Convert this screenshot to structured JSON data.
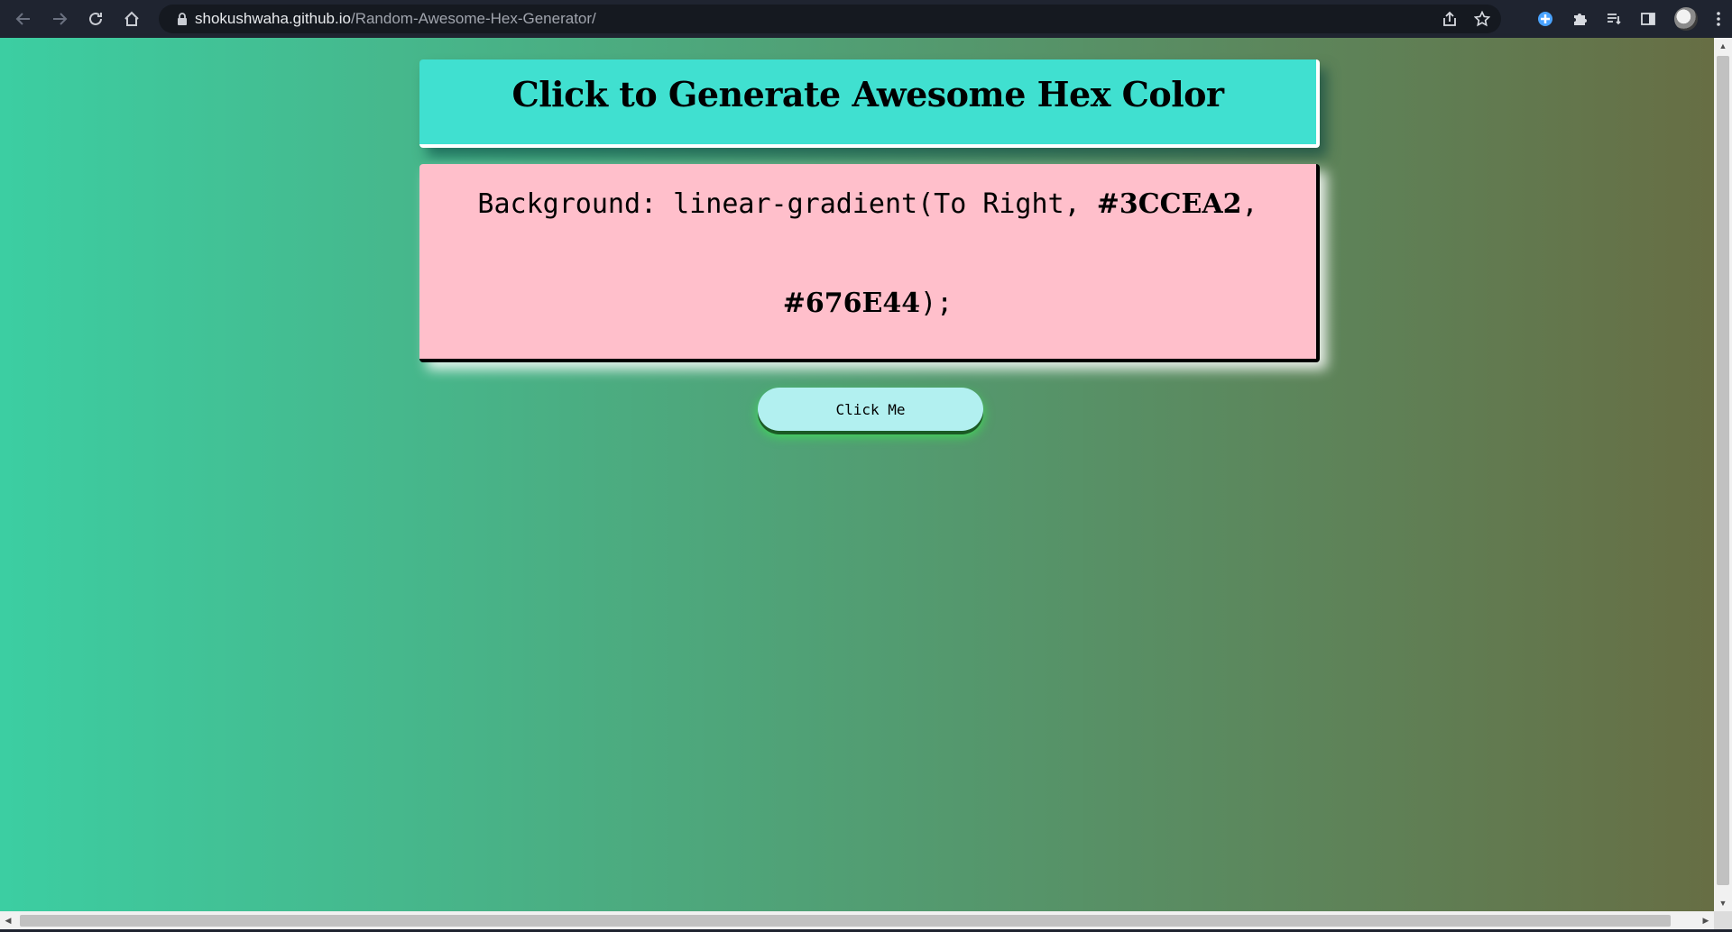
{
  "browser": {
    "url_host": "shokushwaha.github.io",
    "url_path": "/Random-Awesome-Hex-Generator/",
    "icons": {
      "back": "back-arrow-icon",
      "forward": "forward-arrow-icon",
      "reload": "reload-icon",
      "home": "home-icon",
      "lock": "lock-icon",
      "share": "share-icon",
      "bookmark": "star-icon",
      "extension_active": "extension-icon",
      "extensions": "puzzle-icon",
      "reading_list": "reading-list-icon",
      "side_panel": "side-panel-icon",
      "menu": "kebab-menu-icon"
    }
  },
  "page": {
    "heading": "Click to Generate Awesome Hex Color",
    "css_prefix": "Background: linear-gradient(To Right, ",
    "color1": "#3CCEA2",
    "separator": ",",
    "color2": "#676E44",
    "css_suffix": ");",
    "button_label": "Click Me"
  },
  "colors": {
    "gradient_start": "#3CCEA2",
    "gradient_end": "#676E44",
    "title_card_bg": "#40E0D0",
    "code_card_bg": "#FFBFCB",
    "button_bg": "#B2F0F0"
  }
}
